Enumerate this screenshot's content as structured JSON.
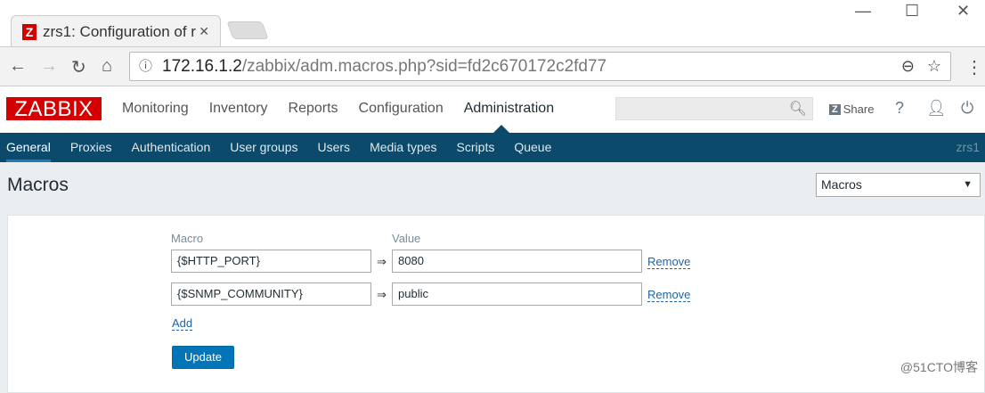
{
  "browser": {
    "tab_title": "zrs1: Configuration of r",
    "favicon": "Z",
    "url_host": "172.16.1.2",
    "url_path": "/zabbix/adm.macros.php?sid=fd2c670172c2fd77"
  },
  "header": {
    "logo": "ZABBIX",
    "menu": [
      "Monitoring",
      "Inventory",
      "Reports",
      "Configuration",
      "Administration"
    ],
    "share_icon": "Z",
    "share": "Share",
    "help": "?"
  },
  "subnav": {
    "items": [
      "General",
      "Proxies",
      "Authentication",
      "User groups",
      "Users",
      "Media types",
      "Scripts",
      "Queue"
    ],
    "server": "zrs1"
  },
  "page": {
    "title": "Macros",
    "select_value": "Macros"
  },
  "form": {
    "macro_label": "Macro",
    "value_label": "Value",
    "arrow": "⇒",
    "rows": [
      {
        "macro": "{$HTTP_PORT}",
        "value": "8080",
        "remove": "Remove"
      },
      {
        "macro": "{$SNMP_COMMUNITY}",
        "value": "public",
        "remove": "Remove"
      }
    ],
    "add": "Add",
    "update": "Update"
  },
  "watermark": "@51CTO博客"
}
